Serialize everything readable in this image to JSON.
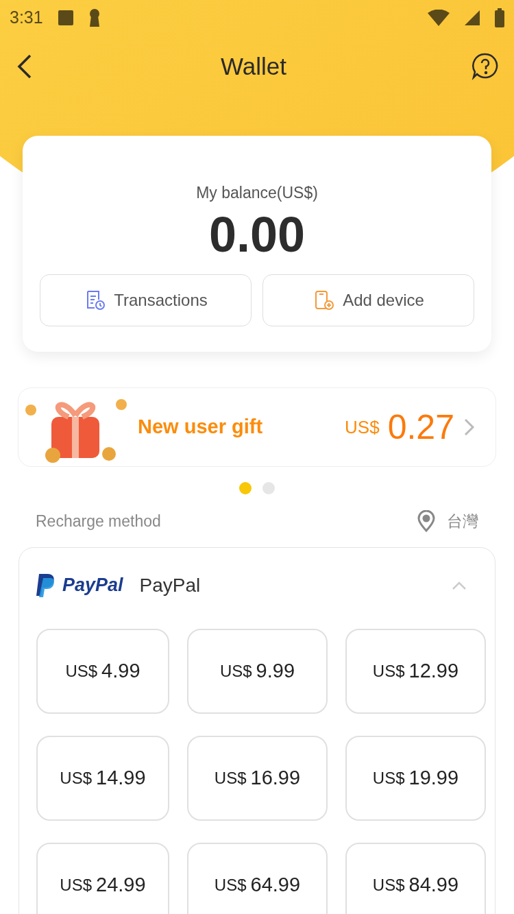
{
  "status_bar": {
    "time": "3:31"
  },
  "header": {
    "title": "Wallet"
  },
  "balance": {
    "label": "My balance(US$)",
    "amount": "0.00",
    "actions": [
      {
        "kind": "transactions",
        "label": "Transactions"
      },
      {
        "kind": "device",
        "label": "Add device"
      }
    ]
  },
  "gift_banner": {
    "title": "New user gift",
    "currency": "US$",
    "amount": "0.27"
  },
  "carousel_dots": [
    {
      "selected": true
    },
    {
      "selected": false
    }
  ],
  "recharge": {
    "title": "Recharge method",
    "region": "台灣"
  },
  "method": {
    "logo_text": "PayPal",
    "name": "PayPal",
    "expanded": true,
    "amounts": [
      {
        "currency": "US$",
        "value": "4.99"
      },
      {
        "currency": "US$",
        "value": "9.99"
      },
      {
        "currency": "US$",
        "value": "12.99"
      },
      {
        "currency": "US$",
        "value": "14.99"
      },
      {
        "currency": "US$",
        "value": "16.99"
      },
      {
        "currency": "US$",
        "value": "19.99"
      },
      {
        "currency": "US$",
        "value": "24.99"
      },
      {
        "currency": "US$",
        "value": "64.99"
      },
      {
        "currency": "US$",
        "value": "84.99"
      }
    ]
  }
}
